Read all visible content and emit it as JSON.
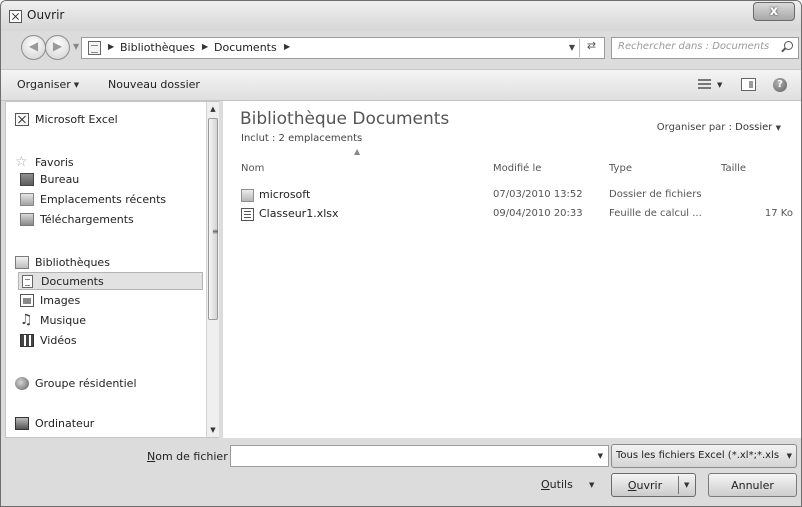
{
  "window": {
    "title": "Ouvrir",
    "close_glyph": "x"
  },
  "address_bar": {
    "crumbs": [
      "Bibliothèques",
      "Documents"
    ]
  },
  "search": {
    "placeholder": "Rechercher dans : Documents"
  },
  "toolbar": {
    "organize_label": "Organiser",
    "new_folder_label": "Nouveau dossier"
  },
  "sidebar": {
    "excel": "Microsoft Excel",
    "favorites": "Favoris",
    "fav_items": [
      "Bureau",
      "Emplacements récents",
      "Téléchargements"
    ],
    "libraries": "Bibliothèques",
    "lib_items": [
      "Documents",
      "Images",
      "Musique",
      "Vidéos"
    ],
    "homegroup": "Groupe résidentiel",
    "computer": "Ordinateur",
    "selected": "Documents"
  },
  "content": {
    "title": "Bibliothèque Documents",
    "subtitle": "Inclut : 2 emplacements",
    "arrange_label": "Organiser par :",
    "arrange_value": "Dossier",
    "columns": {
      "name": "Nom",
      "modified": "Modifié le",
      "type": "Type",
      "size": "Taille"
    },
    "files": [
      {
        "name": "microsoft",
        "modified": "07/03/2010 13:52",
        "type": "Dossier de fichiers",
        "size": "",
        "icon": "folder-icon"
      },
      {
        "name": "Classeur1.xlsx",
        "modified": "09/04/2010 20:33",
        "type": "Feuille de calcul ...",
        "size": "17 Ko",
        "icon": "excel-file-icon"
      }
    ]
  },
  "bottom": {
    "filename_label_hotkey": "N",
    "filename_label_rest": "om de fichier :",
    "filename_value": "",
    "filter": "Tous les fichiers Excel (*.xl*;*.xls",
    "tools_hotkey": "O",
    "tools_rest": "utils",
    "open_hotkey": "O",
    "open_rest": "uvrir",
    "cancel": "Annuler"
  }
}
